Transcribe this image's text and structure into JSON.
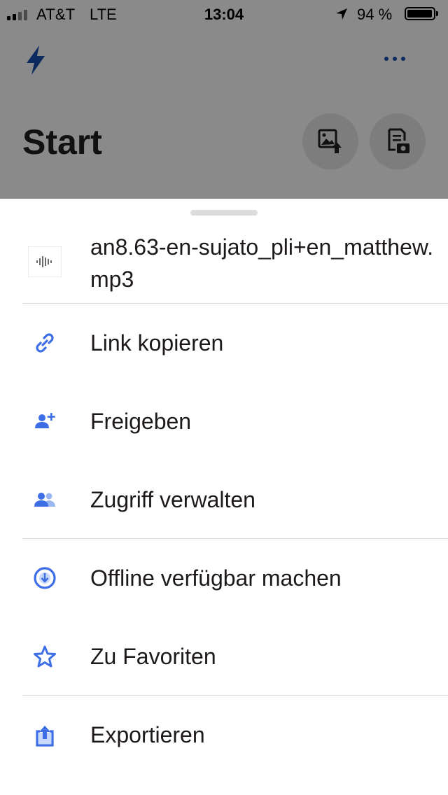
{
  "status_bar": {
    "carrier": "AT&T",
    "network": "LTE",
    "time": "13:04",
    "battery_percent": "94 %",
    "battery_level": 0.94
  },
  "app": {
    "title": "Start",
    "logo_icon": "bolt-icon",
    "more_icon": "more-icon",
    "actions": [
      {
        "icon": "upload-photo-icon"
      },
      {
        "icon": "scan-document-icon"
      }
    ]
  },
  "sheet": {
    "file_name": "an8.63-en-sujato_pli+en_matthew.mp3",
    "file_icon": "audio-file-icon",
    "items": [
      {
        "label": "Link kopieren",
        "icon": "link-icon"
      },
      {
        "label": "Freigeben",
        "icon": "share-user-icon"
      },
      {
        "label": "Zugriff verwalten",
        "icon": "people-icon"
      },
      {
        "label": "Offline verfügbar machen",
        "icon": "offline-download-icon"
      },
      {
        "label": "Zu Favoriten",
        "icon": "star-icon"
      },
      {
        "label": "Exportieren",
        "icon": "export-icon"
      }
    ]
  },
  "colors": {
    "accent": "#3d6ee6",
    "overlay": "#8a8a8a",
    "text": "#1e1919",
    "logo": "#0d2a5e"
  }
}
